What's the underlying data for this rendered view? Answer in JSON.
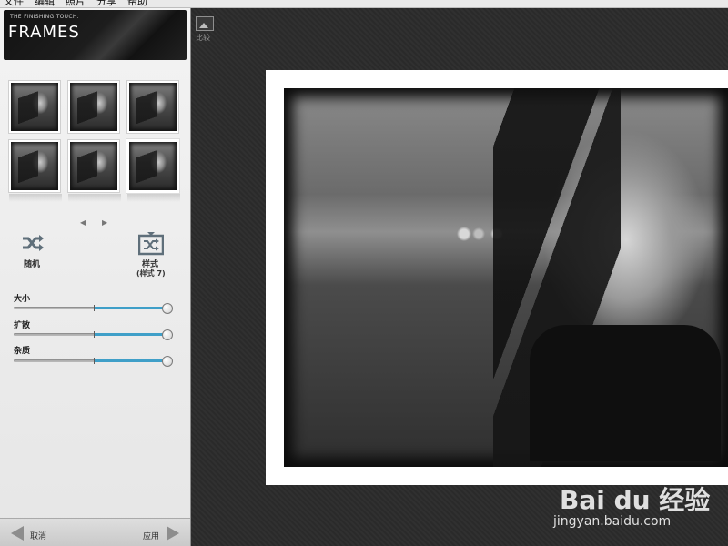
{
  "menu": {
    "items": [
      "文件",
      "编辑",
      "照片",
      "分享",
      "帮助"
    ]
  },
  "header": {
    "tagline": "THE FINISHING TOUCH.",
    "title": "FRAMES"
  },
  "tools": {
    "random_label": "随机",
    "style_label": "样式",
    "style_value": "(样式 7)"
  },
  "sliders": [
    {
      "label": "大小",
      "value": 1.0
    },
    {
      "label": "扩散",
      "value": 1.0
    },
    {
      "label": "杂质",
      "value": 1.0
    }
  ],
  "footer": {
    "cancel_label": "取消",
    "apply_label": "应用"
  },
  "canvas": {
    "compare_label": "比较"
  },
  "watermark": {
    "brand": "Bai du 经验",
    "url": "jingyan.baidu.com"
  },
  "colors": {
    "slider_fill": "#3f9fc8"
  }
}
